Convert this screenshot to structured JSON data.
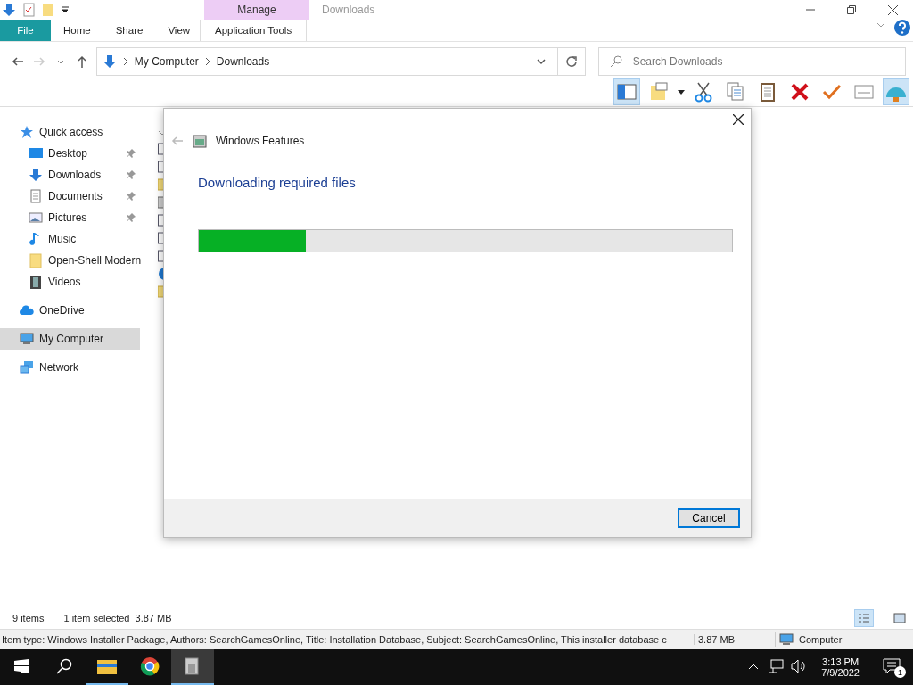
{
  "window": {
    "title": "Downloads"
  },
  "contextual_tab": {
    "group": "Manage",
    "label": "Application Tools",
    "selected": true
  },
  "ribbon_tabs": [
    {
      "label": "File",
      "kind": "file"
    },
    {
      "label": "Home",
      "kind": "tab"
    },
    {
      "label": "Share",
      "kind": "tab"
    },
    {
      "label": "View",
      "kind": "tab"
    }
  ],
  "address": {
    "path": [
      "My Computer",
      "Downloads"
    ]
  },
  "search": {
    "placeholder": "Search Downloads"
  },
  "sidebar": {
    "items": [
      {
        "label": "Quick access",
        "kind": "star",
        "selected": false,
        "children": [
          {
            "label": "Desktop",
            "kind": "desktop",
            "pinned": true,
            "selected": false
          },
          {
            "label": "Downloads",
            "kind": "download",
            "pinned": true,
            "selected": false
          },
          {
            "label": "Documents",
            "kind": "document",
            "pinned": true,
            "selected": false
          },
          {
            "label": "Pictures",
            "kind": "pictures",
            "pinned": true,
            "selected": false
          },
          {
            "label": "Music",
            "kind": "music",
            "pinned": false,
            "selected": false
          },
          {
            "label": "Open-Shell Modern",
            "kind": "folder",
            "pinned": false,
            "selected": false
          },
          {
            "label": "Videos",
            "kind": "video",
            "pinned": false,
            "selected": false
          }
        ]
      },
      {
        "label": "OneDrive",
        "kind": "cloud",
        "selected": false
      },
      {
        "label": "My Computer",
        "kind": "computer",
        "selected": true
      },
      {
        "label": "Network",
        "kind": "network",
        "selected": false
      }
    ]
  },
  "dialog": {
    "title": "Windows Features",
    "heading": "Downloading required files",
    "progress": {
      "level": 0.2
    },
    "buttons": [
      "Cancel"
    ]
  },
  "status_bar": {
    "items": "9 items",
    "selection": "1 item selected  3.87 MB"
  },
  "details_bar": {
    "text": "Item type: Windows Installer Package, Authors: SearchGamesOnline, Title: Installation Database, Subject: SearchGamesOnline, This installer database c",
    "size": "3.87 MB",
    "location": "Computer"
  },
  "taskbar": {
    "time": "3:13 PM",
    "date": "7/9/2022",
    "notifications": "1"
  }
}
